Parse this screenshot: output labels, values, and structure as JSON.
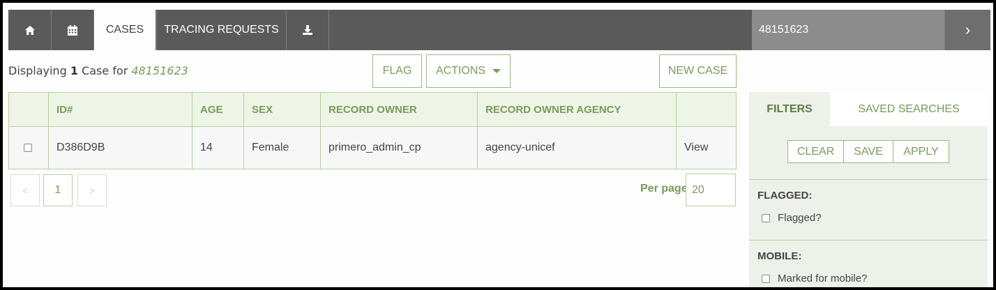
{
  "nav": {
    "tabs": [
      "CASES",
      "TRACING REQUESTS"
    ],
    "active_tab": "CASES",
    "right_label": "48151623",
    "icons": [
      "home-icon",
      "calendar-icon",
      "download-icon",
      "chevron-right-icon"
    ]
  },
  "header": {
    "prefix": "Displaying ",
    "count": "1",
    "middle": " Case for ",
    "query": "48151623"
  },
  "toolbar": {
    "flag_label": "FLAG",
    "actions_label": "ACTIONS",
    "new_case_label": "NEW CASE"
  },
  "table": {
    "columns": [
      "",
      "ID#",
      "AGE",
      "SEX",
      "RECORD OWNER",
      "RECORD OWNER AGENCY",
      ""
    ],
    "rows": [
      {
        "id": "D386D9B",
        "age": "14",
        "sex": "Female",
        "owner": "primero_admin_cp",
        "agency": "agency-unicef",
        "action": "View"
      }
    ]
  },
  "pagination": {
    "prev": "<",
    "current": "1",
    "next": ">",
    "per_page_label": "Per page",
    "per_page_value": "20"
  },
  "filters": {
    "tabs": [
      "FILTERS",
      "SAVED SEARCHES"
    ],
    "active_tab": "FILTERS",
    "buttons": [
      "CLEAR",
      "SAVE",
      "APPLY"
    ],
    "sections": [
      {
        "heading": "FLAGGED:",
        "option": "Flagged?"
      },
      {
        "heading": "MOBILE:",
        "option": "Marked for mobile?"
      }
    ]
  },
  "colors": {
    "accent": "#7a9a5a",
    "nav_bg": "#5a5a5a",
    "border": "#b7cf9e"
  }
}
